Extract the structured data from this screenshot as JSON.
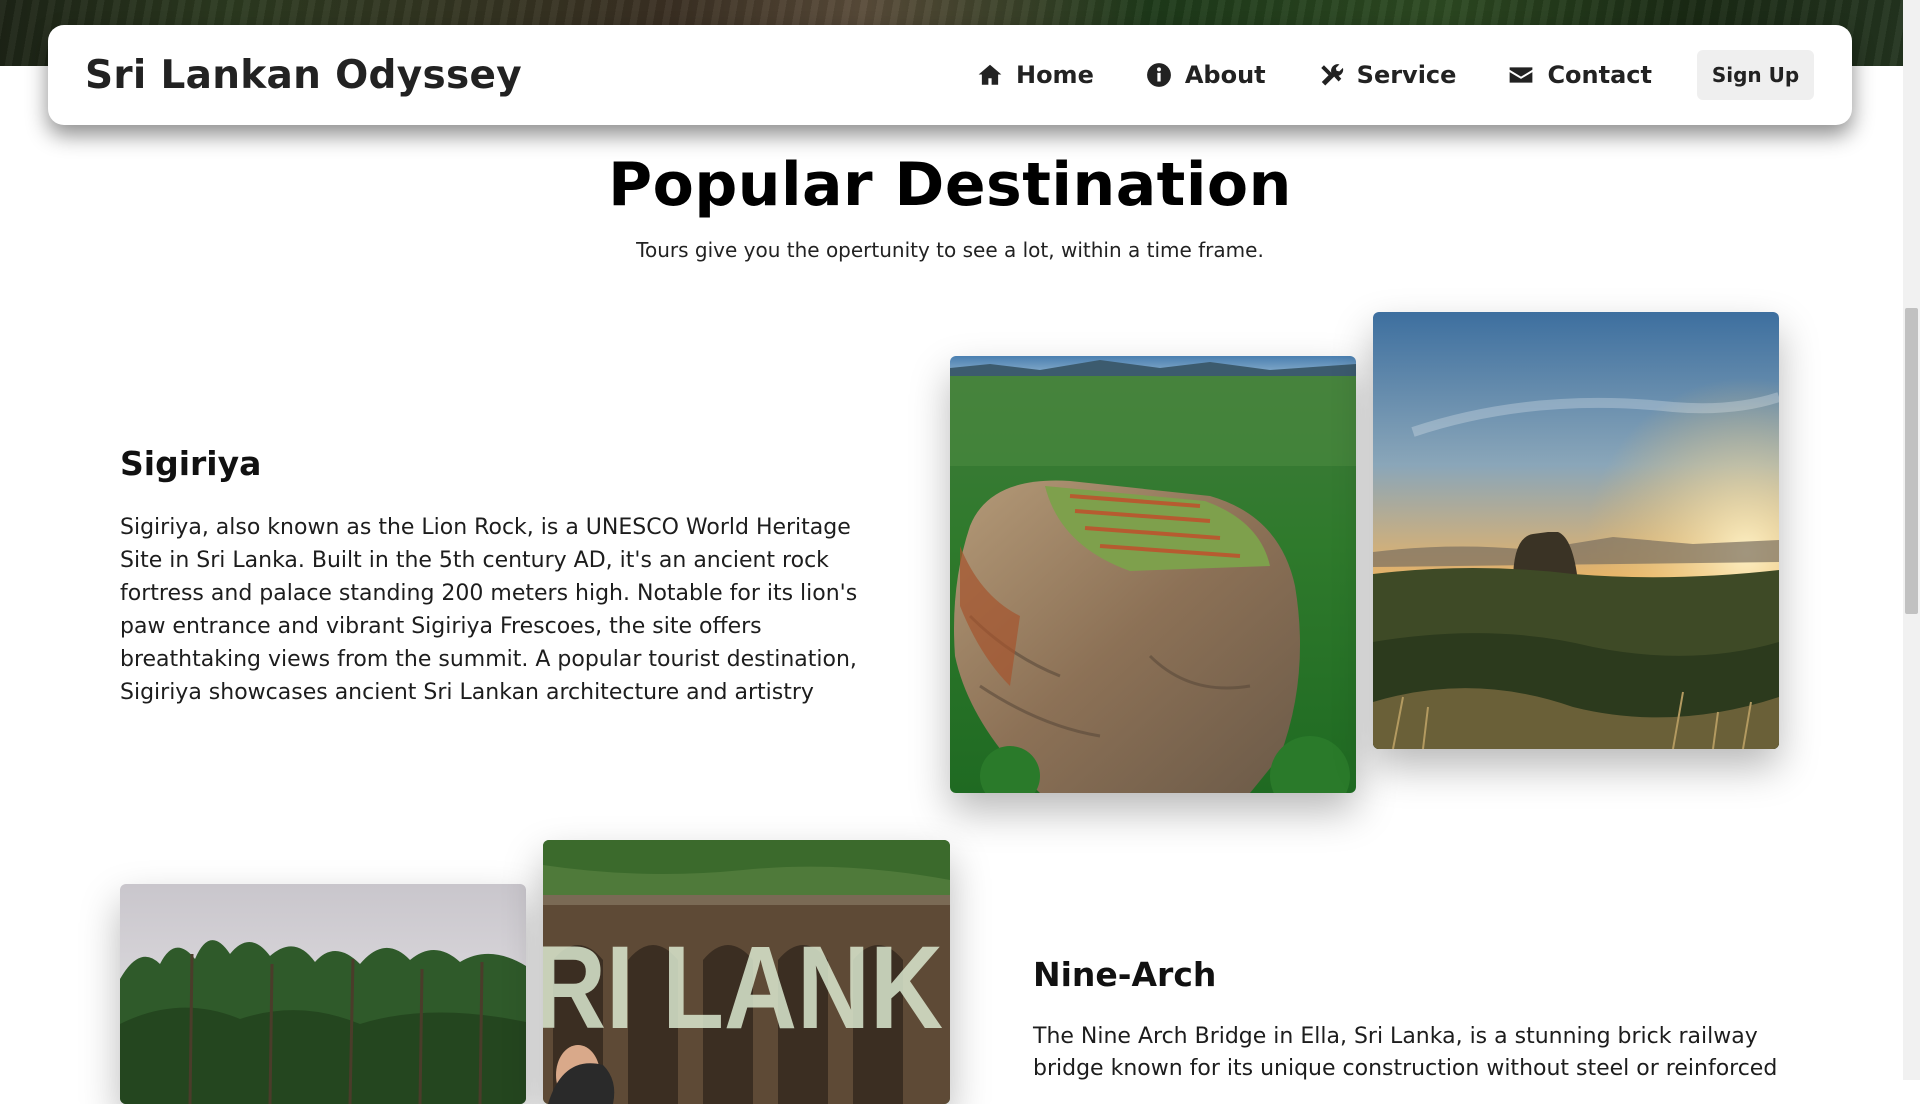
{
  "brand": "Sri Lankan Odyssey",
  "nav": {
    "home": "Home",
    "about": "About",
    "service": "Service",
    "contact": "Contact",
    "signup": "Sign Up"
  },
  "section": {
    "title": "Popular Destination",
    "subtitle": "Tours give you the opertunity to see a lot, within a time frame."
  },
  "destinations": [
    {
      "title": "Sigiriya",
      "desc_lines": [
        "Sigiriya, also known as the Lion Rock, is a UNESCO World Heritage",
        "Site in Sri Lanka. Built in the 5th century AD, it's an ancient rock",
        "fortress and palace standing 200 meters high. Notable for its lion's",
        "paw entrance and vibrant Sigiriya Frescoes, the site offers",
        "breathtaking views from the summit. A popular tourist destination,",
        "Sigiriya showcases ancient Sri Lankan architecture and artistry"
      ]
    },
    {
      "title": "Nine-Arch",
      "desc_lines": [
        "The Nine Arch Bridge in Ella, Sri Lanka, is a stunning brick railway",
        "bridge known for its unique construction without steel or reinforced"
      ],
      "photo_text": "RI LANK"
    }
  ],
  "icons": {
    "home": "home-icon",
    "about": "info-circle-icon",
    "service": "tools-icon",
    "contact": "envelope-icon"
  }
}
